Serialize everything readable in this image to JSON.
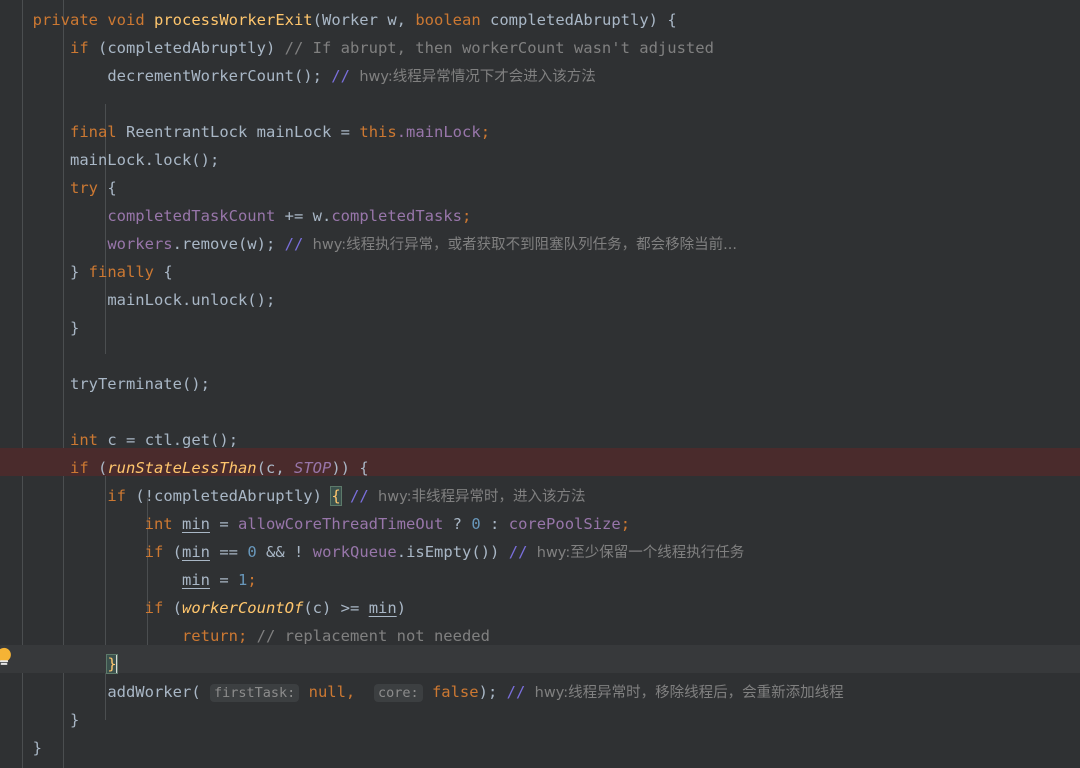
{
  "editor": {
    "theme_name": "darcula",
    "background": "#2f3133",
    "current_line_background": "#37393b",
    "breakpoint_line_background": "#4a2b2c",
    "default_text_color": "#a9b7c6",
    "font_size_px": 15.5,
    "line_height_px": 28,
    "indent_guide_color": "#4b4e50",
    "caret_color": "#d8d8d8",
    "brace_match_background": "#3b514d",
    "param_hint_background": "#3c3f41",
    "colors": {
      "keyword": "#cc7832",
      "method": "#ffc66d",
      "field": "#9876aa",
      "number": "#6897bb",
      "comment": "#808080",
      "comment_marker": "#7a6fdc",
      "identifier": "#a9b7c6"
    }
  },
  "gutter": {
    "intention_icon": "lightbulb-icon",
    "intention_icon_color": "#f5b335",
    "intention_line": 23
  },
  "indent_guides": [
    22,
    63,
    105,
    147,
    189
  ],
  "code": {
    "language": "java",
    "lines": [
      {
        "n": 1,
        "indent": 0,
        "text": "private void processWorkerExit(Worker w, boolean completedAbruptly) {"
      },
      {
        "n": 2,
        "indent": 1,
        "text": "if (completedAbruptly) // If abrupt, then workerCount wasn't adjusted"
      },
      {
        "n": 3,
        "indent": 2,
        "text": "decrementWorkerCount(); // hwy:线程异常情况下才会进入该方法"
      },
      {
        "n": 4,
        "indent": 0,
        "text": ""
      },
      {
        "n": 5,
        "indent": 1,
        "text": "final ReentrantLock mainLock = this.mainLock;"
      },
      {
        "n": 6,
        "indent": 1,
        "text": "mainLock.lock();"
      },
      {
        "n": 7,
        "indent": 1,
        "text": "try {"
      },
      {
        "n": 8,
        "indent": 2,
        "text": "completedTaskCount += w.completedTasks;"
      },
      {
        "n": 9,
        "indent": 2,
        "text": "workers.remove(w); // hwy:线程执行异常，或者获取不到阻塞队列任务，都会移除当前..."
      },
      {
        "n": 10,
        "indent": 1,
        "text": "} finally {"
      },
      {
        "n": 11,
        "indent": 2,
        "text": "mainLock.unlock();"
      },
      {
        "n": 12,
        "indent": 1,
        "text": "}"
      },
      {
        "n": 13,
        "indent": 0,
        "text": ""
      },
      {
        "n": 14,
        "indent": 1,
        "text": "tryTerminate();"
      },
      {
        "n": 15,
        "indent": 0,
        "text": ""
      },
      {
        "n": 16,
        "indent": 1,
        "text": "int c = ctl.get();"
      },
      {
        "n": 17,
        "indent": 1,
        "text": "if (runStateLessThan(c, STOP)) {"
      },
      {
        "n": 18,
        "indent": 2,
        "text": "if (!completedAbruptly) { // hwy:非线程异常时，进入该方法"
      },
      {
        "n": 19,
        "indent": 3,
        "text": "int min = allowCoreThreadTimeOut ? 0 : corePoolSize;"
      },
      {
        "n": 20,
        "indent": 3,
        "text": "if (min == 0 && ! workQueue.isEmpty()) // hwy:至少保留一个线程执行任务"
      },
      {
        "n": 21,
        "indent": 4,
        "text": "min = 1;"
      },
      {
        "n": 22,
        "indent": 3,
        "text": "if (workerCountOf(c) >= min)"
      },
      {
        "n": 23,
        "indent": 4,
        "text": "return; // replacement not needed"
      },
      {
        "n": 24,
        "indent": 2,
        "text": "}"
      },
      {
        "n": 25,
        "indent": 2,
        "text": "addWorker( firstTask: null,  core: false); // hwy:线程异常时，移除线程后，会重新添加线程"
      },
      {
        "n": 26,
        "indent": 1,
        "text": "}"
      },
      {
        "n": 27,
        "indent": 0,
        "text": "}"
      }
    ],
    "breakpoint_line": 17,
    "caret_line": 24,
    "caret_column": 6,
    "matching_brace_lines": [
      18,
      24
    ]
  },
  "tokens": {
    "l1": {
      "kw1": "private",
      "kw2": "void",
      "method": "processWorkerExit",
      "p1_type": "Worker",
      "p1_name": "w",
      "kw3": "boolean",
      "p2_name": "completedAbruptly"
    },
    "l2": {
      "kw": "if",
      "cond": "completedAbruptly",
      "comment": "// If abrupt, then workerCount wasn't adjusted"
    },
    "l3": {
      "call": "decrementWorkerCount();",
      "marker": "//",
      "comment": "hwy:线程异常情况下才会进入该方法"
    },
    "l5": {
      "kw": "final",
      "type": "ReentrantLock",
      "var": "mainLock",
      "eq": "=",
      "kw2": "this",
      "field": ".mainLock",
      "semi": ";"
    },
    "l6": {
      "text": "mainLock.lock();"
    },
    "l7": {
      "kw": "try",
      "brace": "{"
    },
    "l8": {
      "field1": "completedTaskCount",
      "op": "+=",
      "obj": "w.",
      "field2": "completedTasks",
      "semi": ";"
    },
    "l9": {
      "field": "workers",
      "call": ".remove(w);",
      "marker": "//",
      "comment": "hwy:线程执行异常，或者获取不到阻塞队列任务，都会移除当前..."
    },
    "l10": {
      "brace1": "}",
      "kw": "finally",
      "brace2": "{"
    },
    "l11": {
      "text": "mainLock.unlock();"
    },
    "l12": {
      "text": "}"
    },
    "l14": {
      "text": "tryTerminate();"
    },
    "l16": {
      "kw": "int",
      "var": "c",
      "eq": "=",
      "call": "ctl.get();"
    },
    "l17": {
      "kw": "if",
      "method": "runStateLessThan",
      "arg": "c",
      "const": "STOP",
      "tail": ")) {"
    },
    "l18": {
      "kw": "if",
      "cond": "(!completedAbruptly)",
      "brace": "{",
      "marker": "//",
      "comment": "hwy:非线程异常时，进入该方法"
    },
    "l19": {
      "kw": "int",
      "var": "min",
      "eq": "=",
      "field": "allowCoreThreadTimeOut",
      "q": "?",
      "num": "0",
      "colon": ":",
      "field2": "corePoolSize",
      "semi": ";"
    },
    "l20": {
      "kw": "if",
      "var": "min",
      "op": "==",
      "num": "0",
      "and": "&&",
      "not": "!",
      "field": "workQueue",
      "call": ".isEmpty())",
      "marker": "//",
      "comment": "hwy:至少保留一个线程执行任务"
    },
    "l21": {
      "var": "min",
      "eq": "=",
      "num": "1",
      "semi": ";"
    },
    "l22": {
      "kw": "if",
      "method": "workerCountOf",
      "arg": "c",
      "op": ">=",
      "var": "min"
    },
    "l23": {
      "kw": "return",
      "semi": ";",
      "comment": "// replacement not needed"
    },
    "l24": {
      "brace": "}"
    },
    "l25": {
      "method": "addWorker",
      "hint1": "firstTask:",
      "val1": "null,",
      "hint2": "core:",
      "val2": "false",
      "tail": ");",
      "marker": "//",
      "comment": "hwy:线程异常时，移除线程后，会重新添加线程"
    },
    "l26": {
      "brace": "}"
    },
    "l27": {
      "brace": "}"
    }
  }
}
